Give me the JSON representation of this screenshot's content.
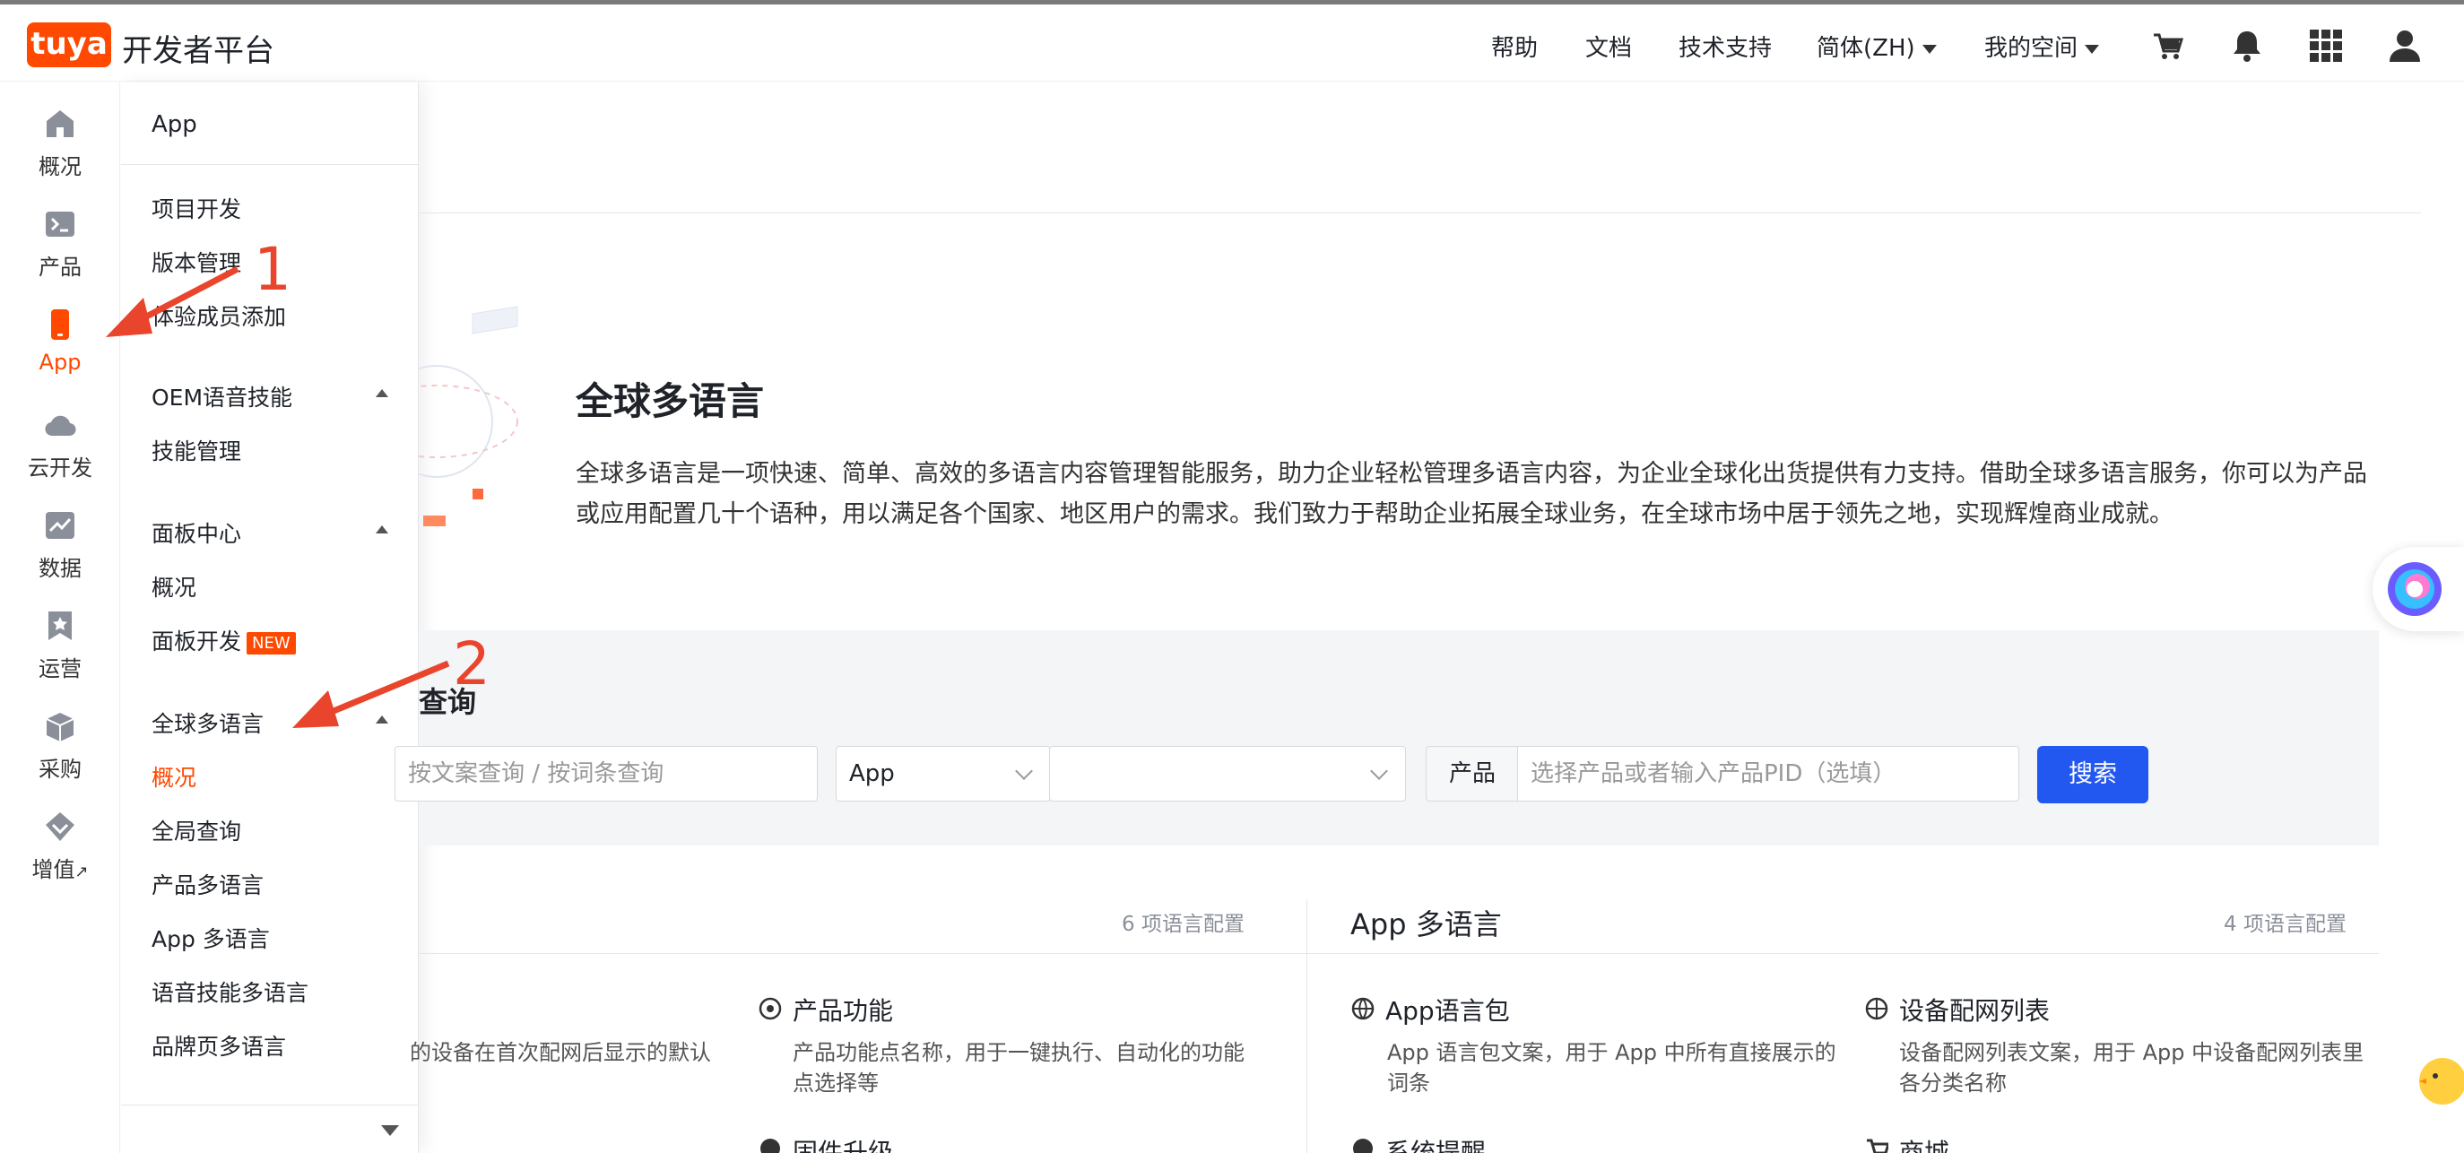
{
  "header": {
    "brand": "tuya",
    "title": "开发者平台",
    "nav": {
      "help": "帮助",
      "docs": "文档",
      "support": "技术支持",
      "language": "简体(ZH)",
      "workspace": "我的空间"
    },
    "icons": [
      "cart-icon",
      "bell-icon",
      "grid-icon",
      "user-icon"
    ]
  },
  "rail": {
    "items": [
      {
        "label": "概况",
        "icon": "home-icon"
      },
      {
        "label": "产品",
        "icon": "terminal-icon"
      },
      {
        "label": "App",
        "icon": "phone-icon"
      },
      {
        "label": "云开发",
        "icon": "cloud-icon"
      },
      {
        "label": "数据",
        "icon": "chart-icon"
      },
      {
        "label": "运营",
        "icon": "bookmark-icon"
      },
      {
        "label": "采购",
        "icon": "box-icon"
      },
      {
        "label": "增值",
        "icon": "diamond-icon",
        "suffix": "↗"
      }
    ],
    "active_index": 2
  },
  "submenu": {
    "title": "App",
    "items_app": [
      "项目开发",
      "版本管理",
      "体验成员添加"
    ],
    "group_oem": "OEM语音技能",
    "items_oem": [
      "技能管理"
    ],
    "group_panel": "面板中心",
    "items_panel": [
      "概况",
      "面板开发"
    ],
    "new_badge": "NEW",
    "group_lang": "全球多语言",
    "items_lang": [
      "概况",
      "全局查询",
      "产品多语言",
      "App 多语言",
      "语音技能多语言",
      "品牌页多语言"
    ],
    "active_item": "概况"
  },
  "hero": {
    "title": "全球多语言",
    "description": "全球多语言是一项快速、简单、高效的多语言内容管理智能服务，助力企业轻松管理多语言内容，为企业全球化出货提供有力支持。借助全球多语言服务，你可以为产品或应用配置几十个语种，用以满足各个国家、地区用户的需求。我们致力于帮助企业拓展全球业务，在全球市场中居于领先之地，实现辉煌商业成就。"
  },
  "search": {
    "title_partial": "查询",
    "text_placeholder_partial": "按文案查询 / 按词条查询",
    "type_select_value": "App",
    "second_select_value": "",
    "product_prefix": "产品",
    "product_placeholder": "选择产品或者输入产品PID（选填）",
    "search_button": "搜索"
  },
  "sections": {
    "left": {
      "count": "6 项语言配置",
      "card_partial_desc": "的设备在首次配网后显示的默认",
      "card1_title": "产品功能",
      "card1_desc": "产品功能点名称，用于一键执行、自动化的功能点选择等",
      "card2_title_partial": "固件升级"
    },
    "right": {
      "title": "App 多语言",
      "count": "4 项语言配置",
      "card1_title": "App语言包",
      "card1_desc": "App 语言包文案，用于 App 中所有直接展示的词条",
      "card2_title": "设备配网列表",
      "card2_desc": "设备配网列表文案，用于 App 中设备配网列表里各分类名称",
      "card3_title_partial": "系统提醒",
      "card4_title_partial": "商城"
    }
  },
  "annotations": {
    "marker1": "1",
    "marker2": "2",
    "color": "#e8452c"
  },
  "colors": {
    "brand": "#ff4800",
    "primary_button": "#2358f0"
  }
}
